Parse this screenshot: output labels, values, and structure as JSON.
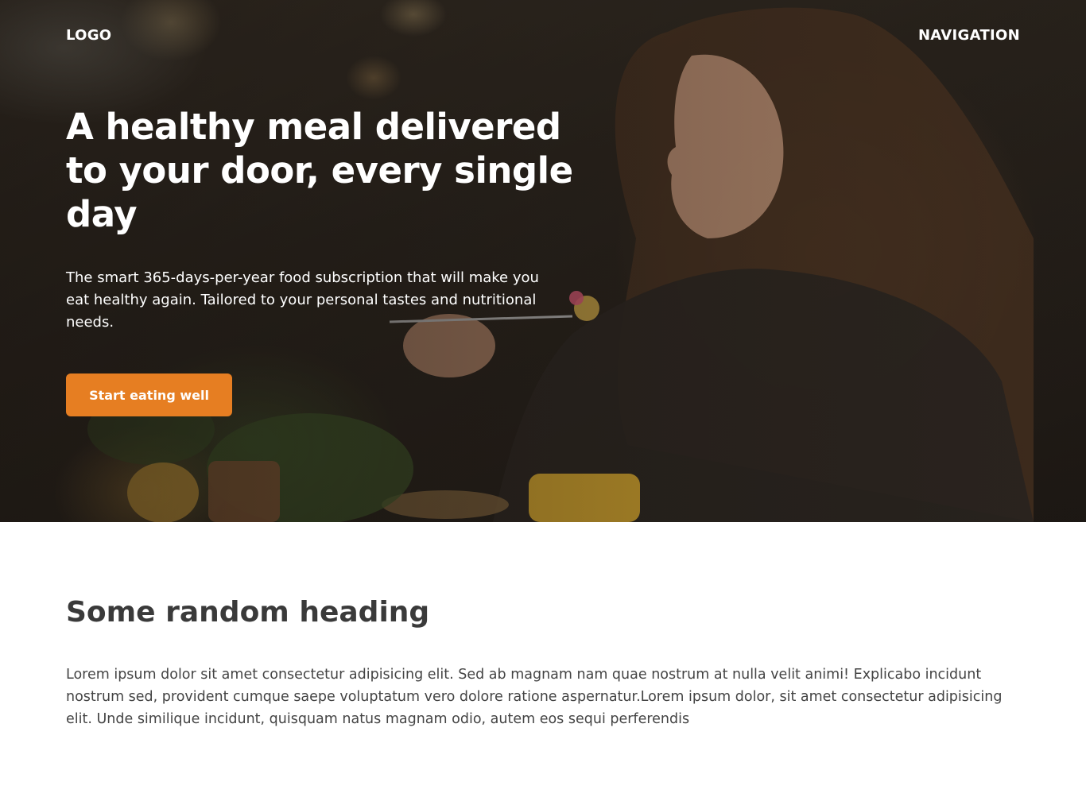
{
  "header": {
    "logo": "LOGO",
    "navigation": "NAVIGATION"
  },
  "hero": {
    "title": "A healthy meal delivered to your door, every single day",
    "text": "The smart 365-days-per-year food subscription that will make you eat healthy again. Tailored to your personal tastes and nutritional needs.",
    "cta_label": "Start eating well",
    "accent_color": "#e67e22"
  },
  "section": {
    "heading": "Some random heading",
    "body": "Lorem ipsum dolor sit amet consectetur adipisicing elit. Sed ab magnam nam quae nostrum at nulla velit animi! Explicabo incidunt nostrum sed, provident cumque saepe voluptatum vero dolore ratione aspernatur.Lorem ipsum dolor, sit amet consectetur adipisicing elit. Unde similique incidunt, quisquam natus magnam odio, autem eos sequi perferendis"
  }
}
